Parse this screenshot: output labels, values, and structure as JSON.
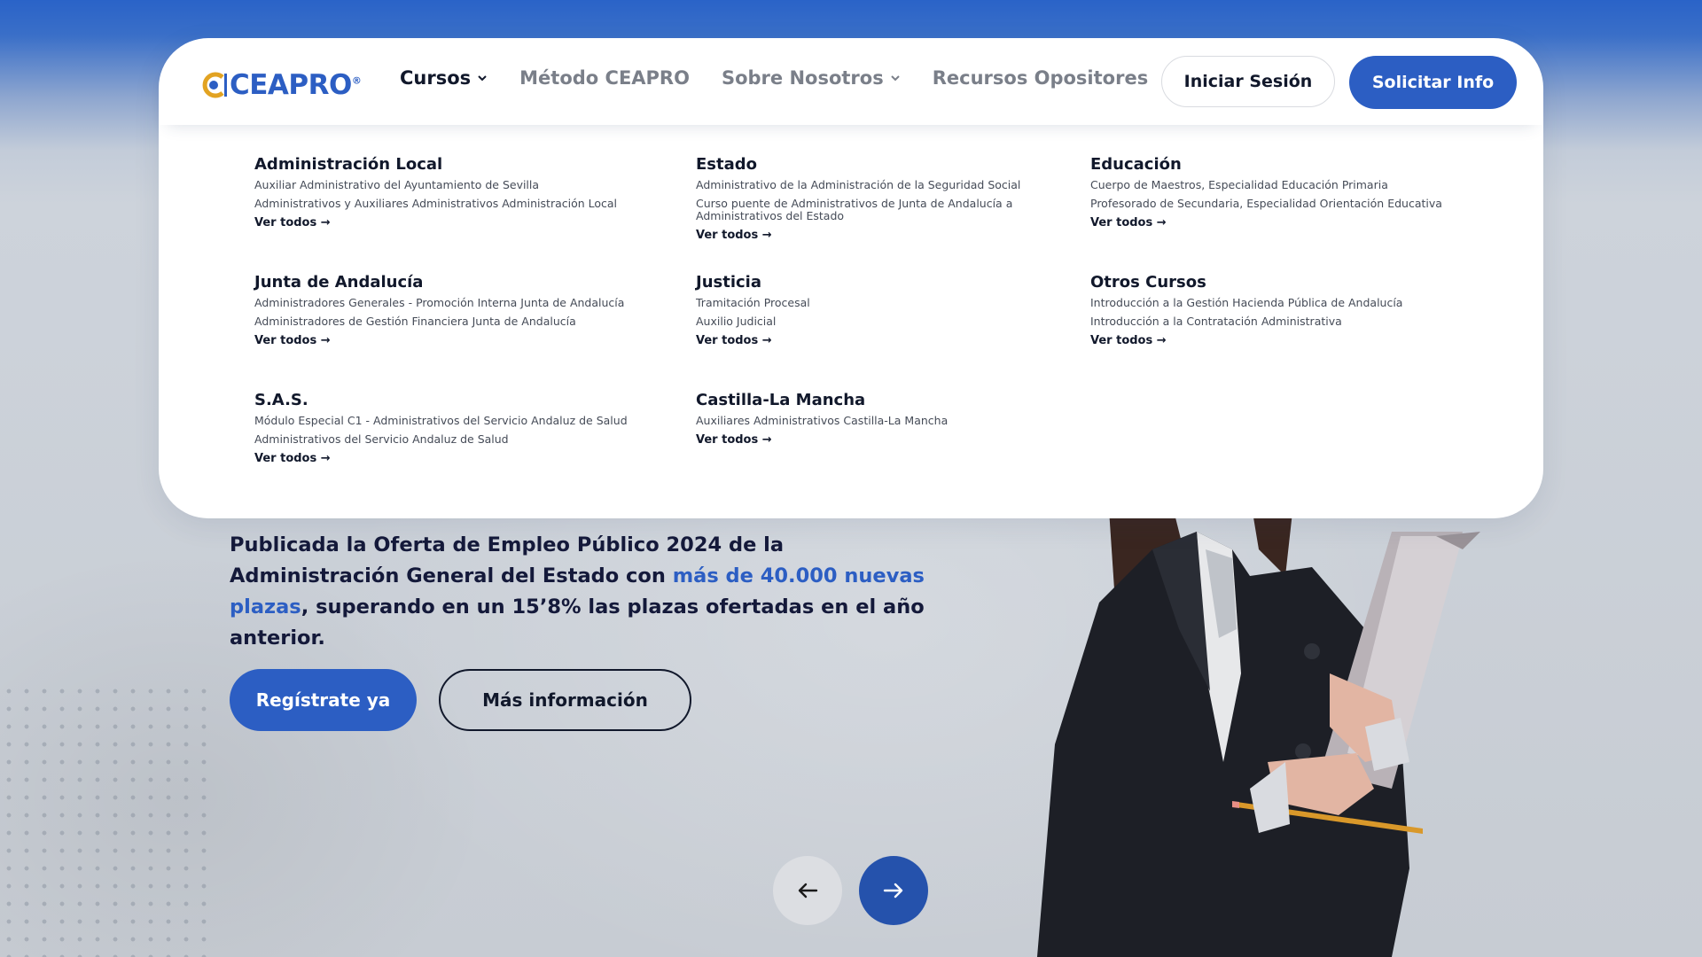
{
  "colors": {
    "brand_blue": "#2c5ec3",
    "dark_text": "#11182b",
    "muted_nav": "#7a7f89"
  },
  "logo": {
    "text": "CEAPRO",
    "reg": "®"
  },
  "nav": {
    "items": [
      {
        "label": "Cursos",
        "has_chevron": true,
        "active": true
      },
      {
        "label": "Método CEAPRO",
        "has_chevron": false
      },
      {
        "label": "Sobre Nosotros",
        "has_chevron": true
      },
      {
        "label": "Recursos Opositores",
        "has_chevron": false
      }
    ],
    "login_label": "Iniciar Sesión",
    "info_label": "Solicitar Info"
  },
  "menu": {
    "groups": [
      {
        "title": "Administración Local",
        "items": [
          "Auxiliar Administrativo del Ayuntamiento de Sevilla",
          "Administrativos y Auxiliares Administrativos Administración Local"
        ],
        "more": "Ver todos →"
      },
      {
        "title": "Estado",
        "items": [
          "Administrativo de la Administración de la Seguridad Social",
          "Curso puente de Administrativos de Junta de Andalucía a Administrativos del Estado"
        ],
        "more": "Ver todos →"
      },
      {
        "title": "Educación",
        "items": [
          "Cuerpo de Maestros, Especialidad Educación Primaria",
          "Profesorado de Secundaria, Especialidad Orientación Educativa"
        ],
        "more": "Ver todos →"
      },
      {
        "title": "Junta de Andalucía",
        "items": [
          "Administradores Generales - Promoción Interna Junta de Andalucía",
          "Administradores de Gestión Financiera Junta de Andalucía"
        ],
        "more": "Ver todos →"
      },
      {
        "title": "Justicia",
        "items": [
          "Tramitación Procesal",
          "Auxilio Judicial"
        ],
        "more": "Ver todos →"
      },
      {
        "title": "Otros Cursos",
        "items": [
          "Introducción a la Gestión Hacienda Pública de Andalucía",
          "Introducción a la Contratación Administrativa"
        ],
        "more": "Ver todos →"
      },
      {
        "title": "S.A.S.",
        "items": [
          "Módulo Especial C1 - Administrativos del Servicio Andaluz de Salud",
          "Administrativos del Servicio Andaluz de Salud"
        ],
        "more": "Ver todos →"
      },
      {
        "title": "Castilla-La Mancha",
        "items": [
          "Auxiliares Administrativos Castilla-La Mancha"
        ],
        "more": "Ver todos →"
      }
    ]
  },
  "hero": {
    "text_before": "Publicada la Oferta de Empleo Público 2024 de la Administración General del Estado con ",
    "highlight": "más de 40.000 nuevas plazas",
    "text_after": ", superando en un 15’8% las plazas ofertadas en el año anterior.",
    "register_label": "Regístrate ya",
    "more_label": "Más información"
  },
  "carousel": {
    "prev_icon": "arrow-left-icon",
    "next_icon": "arrow-right-icon"
  }
}
